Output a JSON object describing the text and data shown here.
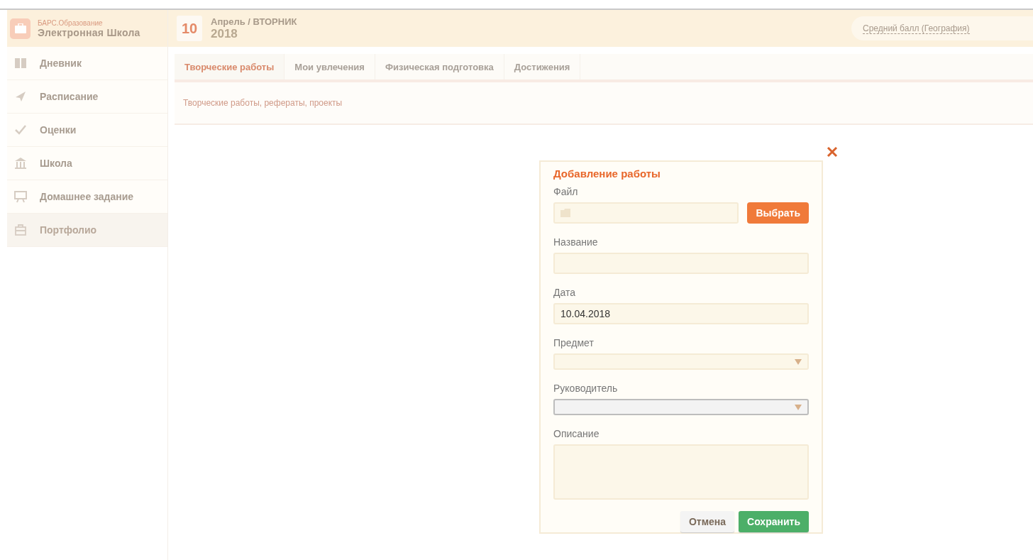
{
  "brand": {
    "small": "БАРС.Образование",
    "large": "Электронная Школа"
  },
  "date": {
    "day": "10",
    "month_weekday": "Апрель / ВТОРНИК",
    "year": "2018"
  },
  "average_link": "Средний балл (География)",
  "sidebar": {
    "items": [
      {
        "label": "Дневник",
        "kind": "diary",
        "selected": false
      },
      {
        "label": "Расписание",
        "kind": "schedule",
        "selected": false
      },
      {
        "label": "Оценки",
        "kind": "grades",
        "selected": false
      },
      {
        "label": "Школа",
        "kind": "school",
        "selected": false
      },
      {
        "label": "Домашнее задание",
        "kind": "homework",
        "selected": false
      },
      {
        "label": "Портфолио",
        "kind": "portfolio",
        "selected": true
      }
    ]
  },
  "tabs": [
    {
      "label": "Творческие работы",
      "selected": true
    },
    {
      "label": "Мои увлечения",
      "selected": false
    },
    {
      "label": "Физическая подготовка",
      "selected": false
    },
    {
      "label": "Достижения",
      "selected": false
    }
  ],
  "panel_text": "Творческие работы, рефераты, проекты",
  "dialog": {
    "title": "Добавление работы",
    "fields": [
      {
        "kind": "file",
        "label": "Файл",
        "button": "Выбрать",
        "focused": false
      },
      {
        "kind": "text",
        "label": "Название",
        "focused": false
      },
      {
        "kind": "text",
        "label": "Дата",
        "value": "10.04.2018",
        "focused": false
      },
      {
        "kind": "select",
        "label": "Предмет",
        "focused": false
      },
      {
        "kind": "select",
        "label": "Руководитель",
        "focused": true
      },
      {
        "kind": "textarea",
        "label": "Описание",
        "focused": false
      }
    ],
    "buttons": [
      {
        "label": "Отмена",
        "kind": "secondary"
      },
      {
        "label": "Сохранить",
        "kind": "primary"
      }
    ]
  }
}
